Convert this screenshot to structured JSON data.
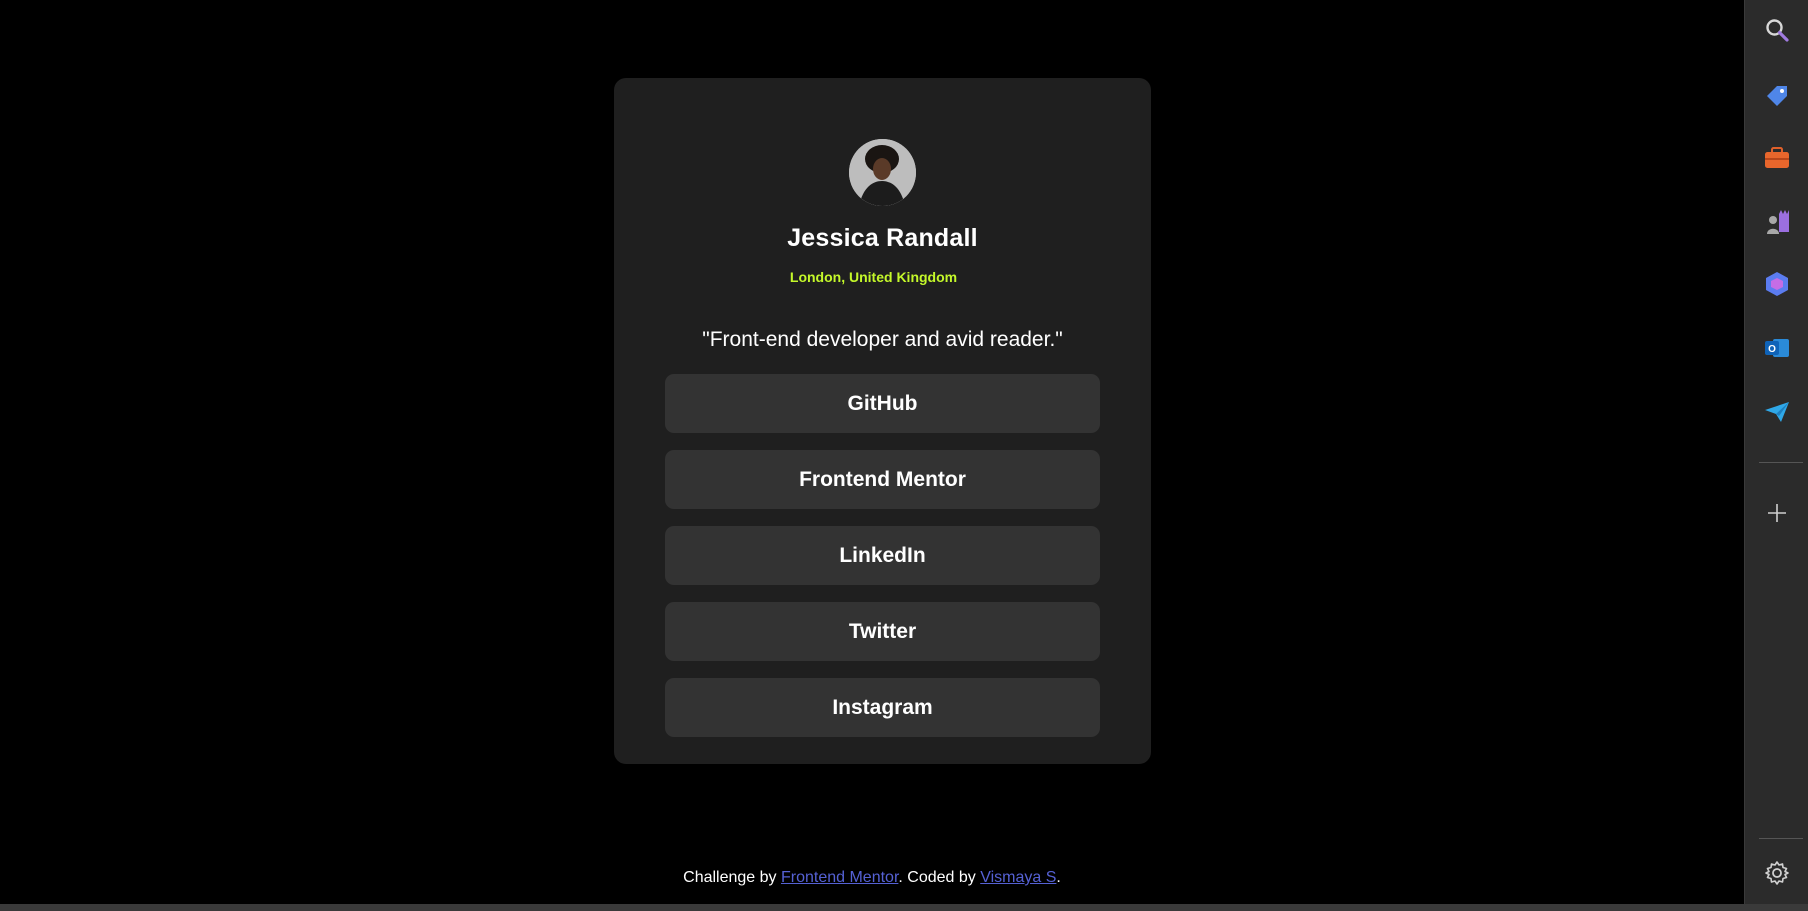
{
  "profile": {
    "name": "Jessica Randall",
    "location": "London, United Kingdom",
    "bio": "\"Front-end developer and avid reader.\""
  },
  "links": [
    {
      "label": "GitHub"
    },
    {
      "label": "Frontend Mentor"
    },
    {
      "label": "LinkedIn"
    },
    {
      "label": "Twitter"
    },
    {
      "label": "Instagram"
    }
  ],
  "footer": {
    "prefix": "Challenge by ",
    "link1": "Frontend Mentor",
    "middle": ". Coded by ",
    "link2": "Vismaya S",
    "suffix": "."
  },
  "colors": {
    "background": "#000000",
    "card": "#1f1f1f",
    "button": "#333333",
    "accent": "#c4f82a",
    "footer_link": "#5561d4"
  },
  "sidebar": {
    "icons": [
      "search-icon",
      "tag-icon",
      "toolbox-icon",
      "games-icon",
      "copilot-icon",
      "outlook-icon",
      "send-icon",
      "add-icon",
      "settings-icon"
    ]
  }
}
